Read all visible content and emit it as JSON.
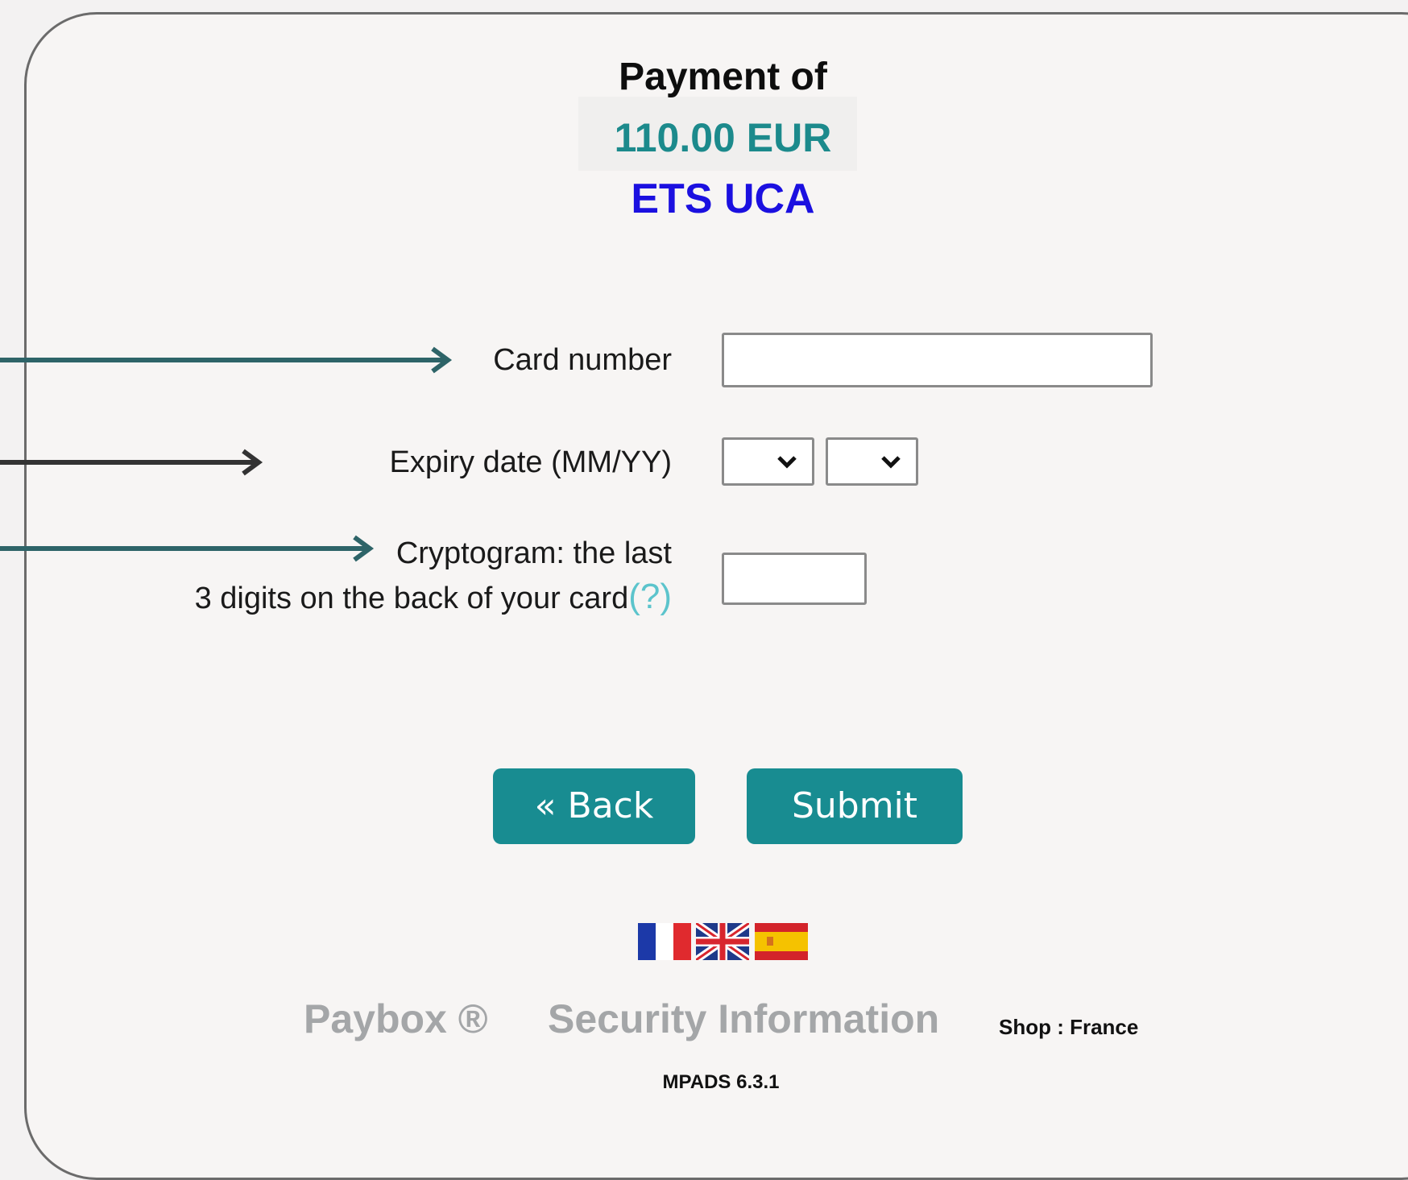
{
  "header": {
    "title": "Payment of",
    "amount": "110.00 EUR",
    "merchant": "ETS UCA"
  },
  "form": {
    "card_number_label": "Card number",
    "card_number_value": "",
    "expiry_label": "Expiry date (MM/YY)",
    "expiry_month": "",
    "expiry_year": "",
    "cvv_label_line1": "Cryptogram: the last",
    "cvv_label_line2": "3 digits on the back of your card",
    "cvv_help": "(?)",
    "cvv_value": ""
  },
  "buttons": {
    "back": "« Back",
    "submit": "Submit"
  },
  "languages": [
    "French flag",
    "UK flag",
    "Spanish flag"
  ],
  "footer": {
    "paybox": "Paybox ®",
    "security": "Security Information",
    "shop": "Shop : France",
    "version": "MPADS 6.3.1"
  },
  "colors": {
    "accent": "#188c91",
    "amount": "#1c8a8c",
    "merchant": "#1b10e0",
    "arrow_teal": "#2e6468",
    "arrow_dark": "#333333"
  }
}
